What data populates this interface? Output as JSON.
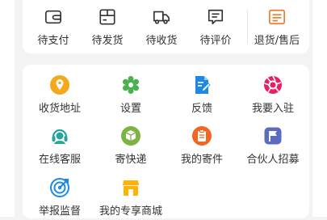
{
  "orders": [
    {
      "label": "待支付",
      "icon": "wallet-icon"
    },
    {
      "label": "待发货",
      "icon": "package-icon"
    },
    {
      "label": "待收货",
      "icon": "truck-icon"
    },
    {
      "label": "待评价",
      "icon": "comment-icon"
    },
    {
      "label": "退货/售后",
      "icon": "refund-icon"
    }
  ],
  "services": [
    {
      "label": "收货地址",
      "icon": "location-pin-icon"
    },
    {
      "label": "设置",
      "icon": "gear-icon"
    },
    {
      "label": "反馈",
      "icon": "feedback-icon"
    },
    {
      "label": "我要入驻",
      "icon": "aperture-icon"
    },
    {
      "label": "在线客服",
      "icon": "customer-service-icon"
    },
    {
      "label": "寄快递",
      "icon": "send-package-icon"
    },
    {
      "label": "我的寄件",
      "icon": "clipboard-icon"
    },
    {
      "label": "合伙人招募",
      "icon": "flag-icon"
    },
    {
      "label": "举报监督",
      "icon": "target-icon"
    },
    {
      "label": "我的专享商城",
      "icon": "shop-icon"
    }
  ],
  "colors": {
    "refund": "#f07a2a",
    "location": "#f4a81d",
    "gear": "#4caf50",
    "feedback": "#1e88e5",
    "aperture": "#e91e63",
    "headset": "#26a69a",
    "send": "#7cb342",
    "clipboard": "#f26522",
    "flag": "#5c6bc0",
    "target": "#1e88e5",
    "shop": "#ffb300"
  }
}
